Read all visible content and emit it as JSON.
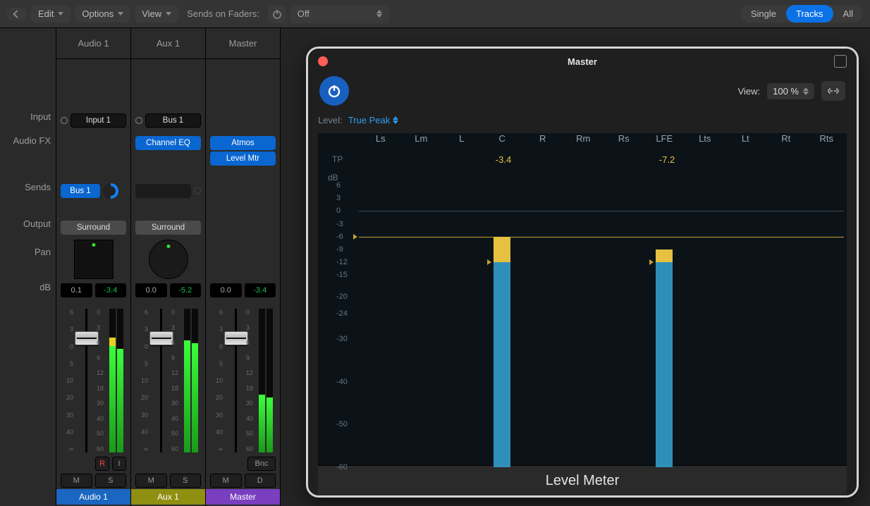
{
  "topbar": {
    "edit": "Edit",
    "options": "Options",
    "view": "View",
    "sof_label": "Sends on Faders:",
    "sof_value": "Off",
    "segs": {
      "single": "Single",
      "tracks": "Tracks",
      "all": "All",
      "active": "tracks"
    }
  },
  "row_labels": {
    "input": "Input",
    "audiofx": "Audio FX",
    "sends": "Sends",
    "output": "Output",
    "pan": "Pan",
    "db": "dB"
  },
  "strips": [
    {
      "id": "audio1",
      "name": "Audio 1",
      "color": "#1a66c0",
      "input": "Input 1",
      "fx": [],
      "sends": [
        "Bus 1"
      ],
      "output": "Surround",
      "pan_type": "box",
      "db": {
        "val": "0.1",
        "peak": "-3.4"
      },
      "fader_pos": 38,
      "meter_green": 74,
      "meter_yellow": 6,
      "btns": {
        "r": "R",
        "i": "I",
        "m": "M",
        "s": "S"
      }
    },
    {
      "id": "aux1",
      "name": "Aux 1",
      "color": "#8f8f12",
      "input": "Bus 1",
      "fx": [
        "Channel EQ"
      ],
      "sends": [],
      "output": "Surround",
      "pan_type": "circle",
      "db": {
        "val": "0.0",
        "peak": "-5.2"
      },
      "fader_pos": 38,
      "meter_green": 78,
      "meter_yellow": 0,
      "btns": {
        "m": "M",
        "s": "S"
      }
    },
    {
      "id": "master",
      "name": "Master",
      "color": "#7a3fbf",
      "input": "",
      "fx": [
        "Atmos",
        "Level Mtr"
      ],
      "sends": [],
      "output": "",
      "pan_type": "",
      "db": {
        "val": "0.0",
        "peak": "-3.4"
      },
      "fader_pos": 38,
      "meter_green": 40,
      "meter_yellow": 0,
      "btns": {
        "bnc": "Bnc",
        "m": "M",
        "d": "D"
      }
    }
  ],
  "fader_scale_left": [
    "6",
    "3",
    "0",
    "5",
    "10",
    "20",
    "30",
    "40",
    "∞"
  ],
  "fader_scale_right": [
    "0",
    "3",
    "6",
    "9",
    "12",
    "18",
    "30",
    "40",
    "50",
    "60"
  ],
  "window": {
    "title": "Master",
    "view_label": "View:",
    "view_value": "100 %",
    "level_label": "Level:",
    "level_value": "True Peak",
    "footer": "Level Meter"
  },
  "chart_data": {
    "type": "bar",
    "channels": [
      "Ls",
      "Lm",
      "L",
      "C",
      "R",
      "Rm",
      "Rs",
      "LFE",
      "Lts",
      "Lt",
      "Rt",
      "Rts"
    ],
    "tp_row_label": "TP",
    "tp_values": {
      "C": "-3.4",
      "LFE": "-7.2"
    },
    "ylabel": "dB",
    "ticks": [
      6,
      3,
      0,
      -3,
      -6,
      -9,
      -12,
      -15,
      -20,
      -24,
      -30,
      -40,
      -50,
      -60
    ],
    "ylim": [
      -60,
      6
    ],
    "zero_at": 0,
    "peak_marker_at": -6,
    "series": [
      {
        "channel": "C",
        "bar_top": -6,
        "bar_bottom": -60,
        "yellow_top": -6,
        "yellow_bottom": -12,
        "hold_at": -12
      },
      {
        "channel": "LFE",
        "bar_top": -9,
        "bar_bottom": -60,
        "yellow_top": -9,
        "yellow_bottom": -12,
        "hold_at": -12
      }
    ]
  }
}
